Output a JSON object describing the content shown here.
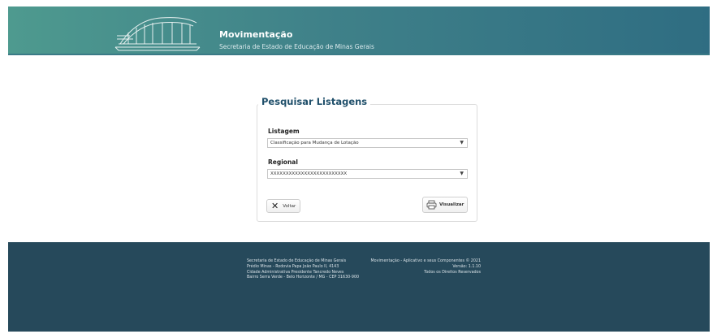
{
  "header": {
    "title": "Movimentação",
    "subtitle": "Secretaria de Estado de Educação de Minas Gerais",
    "logo_icon": "building-logo-icon"
  },
  "form": {
    "legend": "Pesquisar Listagens",
    "listagem_label": "Listagem",
    "listagem_value": "Classificação para Mudança de Lotação",
    "regional_label": "Regional",
    "regional_value": "XXXXXXXXXXXXXXXXXXXXXXXXX",
    "voltar_label": "Voltar",
    "visualizar_label": "Visualizar"
  },
  "footer": {
    "left_lines": [
      "Secretaria de Estado de Educação de Minas Gerais",
      "Prédio Minas - Rodovia Papa João Paulo II, 4143",
      "Cidade Administrativa Presidente Tancredo Neves",
      "Bairro Serra Verde - Belo Horizonte / MG - CEP 31630-900"
    ],
    "right_lines": [
      "Movimentação - Aplicativo e seus Componentes © 2021",
      "Versão: 1.1.10",
      "Todos os Direitos Reservados"
    ]
  },
  "colors": {
    "header_start": "#4e9a8f",
    "header_end": "#2f6d82",
    "footer_bg": "#26495b",
    "legend_text": "#1f4f6a"
  }
}
